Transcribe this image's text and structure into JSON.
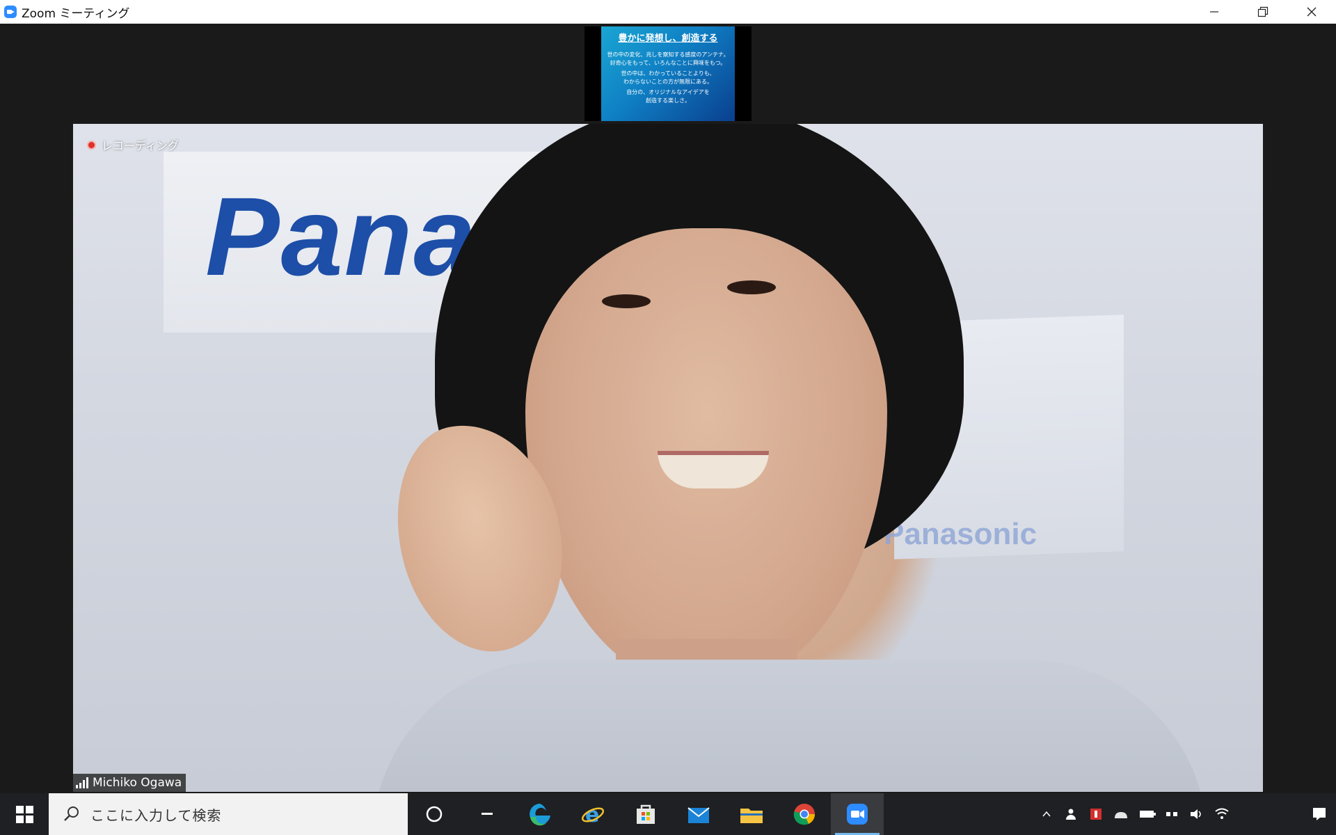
{
  "window": {
    "title": "Zoom ミーティング",
    "controls": [
      "minimize-icon",
      "restore-icon",
      "close-icon"
    ]
  },
  "shared_content": {
    "title": "豊かに発想し、創造する",
    "lines": [
      "世の中の変化、兆しを察知する感度のアンテナ。",
      "好奇心をもって、いろんなことに興味をもつ。",
      "世の中は、わかっていることよりも、",
      "わからないことの方が無限にある。",
      "自分の、オリジナルなアイデアを",
      "創造する楽しさ。"
    ]
  },
  "video": {
    "recording_label": "レコーディング",
    "participant_name": "Michiko Ogawa",
    "background_brand": "Panasonic",
    "background_brand_partial": "Pana"
  },
  "taskbar": {
    "search_text": "ここに入力して検索",
    "pinned_apps": [
      "cortana-icon",
      "task-view-icon",
      "edge-icon",
      "internet-explorer-icon",
      "store-icon",
      "mail-icon",
      "file-explorer-icon",
      "chrome-icon",
      "zoom-icon"
    ],
    "active_app": "zoom-icon",
    "tray_icons": [
      "chevron-up-icon",
      "people-icon",
      "antivirus-icon",
      "network-icon",
      "battery-icon",
      "ime-icon",
      "volume-icon",
      "wifi-icon"
    ],
    "clock_time": "",
    "clock_date": ""
  },
  "colors": {
    "zoom_blue": "#2D8CFF",
    "recording_red": "#e0302b",
    "taskbar_bg": "#1f2023",
    "active_underline": "#76b9ed"
  }
}
